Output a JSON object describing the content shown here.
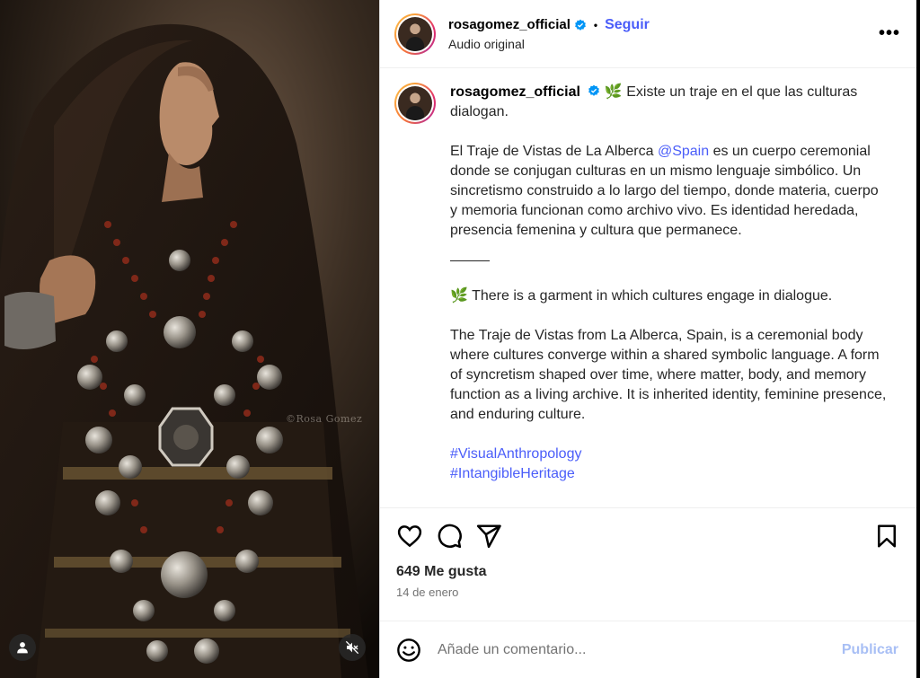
{
  "media": {
    "watermark": "©Rosa Gomez",
    "user_tag_icon": "user-icon",
    "mute_icon": "muted-speaker-icon"
  },
  "header": {
    "username": "rosagomez_official",
    "verified": true,
    "separator": "•",
    "follow_label": "Seguir",
    "subtitle": "Audio original",
    "more_icon": "more-horizontal-icon",
    "more_label": "•••"
  },
  "caption": {
    "username": "rosagomez_official",
    "leaf": "🌿",
    "p1": "Existe un traje en el que las culturas dialogan.",
    "p2_before": "El Traje de Vistas de La Alberca ",
    "p2_mention": "@Spain",
    "p2_after": " es un cuerpo ceremonial donde se conjugan culturas en un mismo lenguaje simbólico. Un sincretismo construido a lo largo del tiempo, donde materia, cuerpo y memoria funcionan como archivo vivo. Es identidad heredada, presencia femenina y cultura que permanece.",
    "p3": "There is a garment in which cultures engage in dialogue.",
    "p4": "The Traje de Vistas from La Alberca, Spain, is a ceremonial body where cultures converge within a shared symbolic language. A form of syncretism shaped over time, where matter, body, and memory function as a living archive. It is inherited identity, feminine presence, and enduring culture.",
    "tags": [
      "#VisualAnthropology",
      "#IntangibleHeritage"
    ]
  },
  "actions": {
    "like_icon": "heart-icon",
    "comment_icon": "comment-icon",
    "share_icon": "send-icon",
    "save_icon": "bookmark-icon"
  },
  "stats": {
    "likes": "649 Me gusta",
    "date": "14 de enero"
  },
  "comment": {
    "emoji_icon": "smile-icon",
    "placeholder": "Añade un comentario...",
    "publish_label": "Publicar"
  },
  "colors": {
    "accent": "#4a5df9",
    "publish_disabled": "#a8bff5",
    "verified": "#0095f6"
  }
}
